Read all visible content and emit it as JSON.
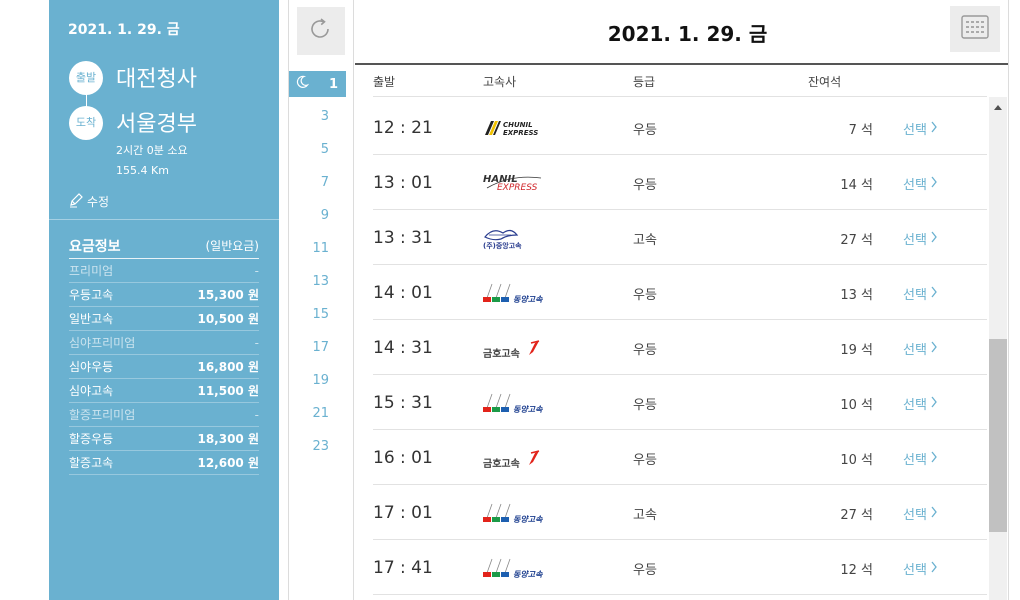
{
  "sidebar": {
    "date": "2021. 1. 29. 금",
    "departure_badge": "출발",
    "departure": "대전청사",
    "arrival_badge": "도착",
    "arrival": "서울경부",
    "duration": "2시간 0분 소요",
    "distance": "155.4 Km",
    "edit_label": "수정",
    "fare_title": "요금정보",
    "fare_type": "(일반요금)",
    "fares": [
      {
        "name": "프리미엄",
        "price": "-",
        "dim": true
      },
      {
        "name": "우등고속",
        "price": "15,300 원",
        "dim": false
      },
      {
        "name": "일반고속",
        "price": "10,500 원",
        "dim": false
      },
      {
        "name": "심야프리미엄",
        "price": "-",
        "dim": true
      },
      {
        "name": "심야우등",
        "price": "16,800 원",
        "dim": false
      },
      {
        "name": "심야고속",
        "price": "11,500 원",
        "dim": false
      },
      {
        "name": "할증프리미엄",
        "price": "-",
        "dim": true
      },
      {
        "name": "할증우등",
        "price": "18,300 원",
        "dim": false
      },
      {
        "name": "할증고속",
        "price": "12,600 원",
        "dim": false
      }
    ]
  },
  "timepanel": {
    "active_hour": "1",
    "hours": [
      "3",
      "5",
      "7",
      "9",
      "11",
      "13",
      "15",
      "17",
      "19",
      "21",
      "23"
    ],
    "refresh_icon": "refresh-icon",
    "night_icon": "moon-icon"
  },
  "header": {
    "title": "2021. 1. 29. 금",
    "calendar_icon": "calendar-icon"
  },
  "table": {
    "columns": {
      "departure": "출발",
      "company": "고속사",
      "class": "등급",
      "seats": "잔여석"
    },
    "select_label": "선택",
    "rows": [
      {
        "time": "12 : 21",
        "company": "CHUNIL EXPRESS",
        "logo": "chunil",
        "class": "우등",
        "seats": "7 석"
      },
      {
        "time": "13 : 01",
        "company": "HANIL EXPRESS",
        "logo": "hanil",
        "class": "우등",
        "seats": "14 석"
      },
      {
        "time": "13 : 31",
        "company": "(주)중앙고속",
        "logo": "jungang",
        "class": "고속",
        "seats": "27 석"
      },
      {
        "time": "14 : 01",
        "company": "동양고속",
        "logo": "dongyang",
        "class": "우등",
        "seats": "13 석"
      },
      {
        "time": "14 : 31",
        "company": "금호고속",
        "logo": "kumho",
        "class": "우등",
        "seats": "19 석"
      },
      {
        "time": "15 : 31",
        "company": "동양고속",
        "logo": "dongyang",
        "class": "우등",
        "seats": "10 석"
      },
      {
        "time": "16 : 01",
        "company": "금호고속",
        "logo": "kumho",
        "class": "우등",
        "seats": "10 석"
      },
      {
        "time": "17 : 01",
        "company": "동양고속",
        "logo": "dongyang",
        "class": "고속",
        "seats": "27 석"
      },
      {
        "time": "17 : 41",
        "company": "동양고속",
        "logo": "dongyang",
        "class": "우등",
        "seats": "12 석"
      }
    ]
  },
  "colors": {
    "accent": "#6ab1d0",
    "chunil_yellow": "#f2c200",
    "hanil_red": "#d0252a",
    "dongyang_red": "#e2231a",
    "dongyang_green": "#1c9a48",
    "dongyang_blue": "#1d5fb0",
    "kumho_red": "#e2231a"
  }
}
